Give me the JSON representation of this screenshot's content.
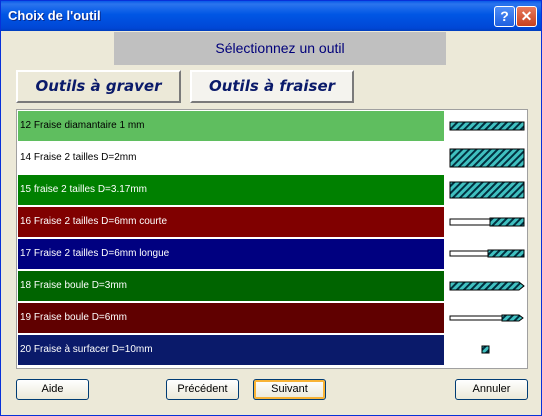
{
  "window": {
    "title": "Choix de l'outil",
    "help_glyph": "?",
    "close_glyph": "✕"
  },
  "header": {
    "text": "Sélectionnez un outil"
  },
  "tabs": [
    {
      "label": "Outils à graver",
      "active": false
    },
    {
      "label": "Outils à fraiser",
      "active": true
    }
  ],
  "tools": [
    {
      "label": "12 Fraise diamantaire 1 mm",
      "bg": "#5fbe5f",
      "fg": "#000000",
      "icon": "bar-full-thin"
    },
    {
      "label": "14 Fraise 2 tailles D=2mm",
      "bg": "#ffffff",
      "fg": "#000000",
      "icon": "bar-full-thick"
    },
    {
      "label": "15 fraise 2 tailles D=3.17mm",
      "bg": "#008000",
      "fg": "#ffffff",
      "icon": "bar-full-medium"
    },
    {
      "label": "16 Fraise 2 tailles D=6mm courte",
      "bg": "#800000",
      "fg": "#ffffff",
      "icon": "bar-short-tip"
    },
    {
      "label": "17 Fraise 2 tailles D=6mm longue",
      "bg": "#000080",
      "fg": "#ffffff",
      "icon": "bar-long-tip"
    },
    {
      "label": "18 Fraise boule D=3mm",
      "bg": "#006400",
      "fg": "#ffffff",
      "icon": "bar-ball"
    },
    {
      "label": "19 Fraise boule D=6mm",
      "bg": "#600000",
      "fg": "#ffffff",
      "icon": "bar-ball-small"
    },
    {
      "label": "20 Fraise à surfacer D=10mm",
      "bg": "#0a1a6a",
      "fg": "#ffffff",
      "icon": "square-small"
    }
  ],
  "buttons": {
    "help": "Aide",
    "previous": "Précédent",
    "next": "Suivant",
    "cancel": "Annuler"
  }
}
